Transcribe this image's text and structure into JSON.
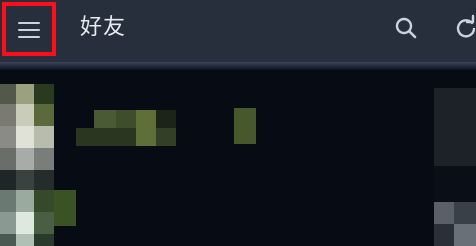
{
  "header": {
    "title": "好友",
    "menu_icon": "menu-icon",
    "search_icon": "search-icon",
    "refresh_icon": "refresh-icon"
  },
  "colors": {
    "app_bar": "#272f3c",
    "background": "#070b14",
    "highlight_box": "#ff0d19",
    "icon": "#cbd3de"
  }
}
